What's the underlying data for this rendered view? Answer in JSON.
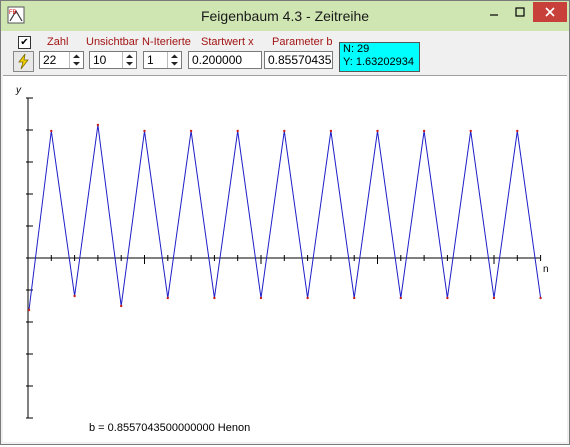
{
  "window": {
    "title": "Feigenbaum 4.3 - Zeitreihe"
  },
  "toolbar": {
    "labels": {
      "zahl": "Zahl",
      "unsichtbar": "Unsichtbar",
      "n_iterierte": "N-Iterierte",
      "startwert": "Startwert x",
      "parameter": "Parameter b"
    },
    "values": {
      "zahl": "22",
      "unsichtbar": "10",
      "n_iterierte": "1",
      "startwert": "0.200000",
      "parameter": "0.85570435"
    },
    "checkbox_checked": true
  },
  "readout": {
    "n": "N: 29",
    "y": "Y: 1.63202934"
  },
  "plot": {
    "y_axis_label": "y",
    "x_axis_label": "n",
    "footer": "b = 0.8557043500000000  Henon"
  },
  "colors": {
    "line": "#1e1ec8",
    "point": "#c81e1e",
    "readout_bg": "#00ffff",
    "label": "#a31515"
  }
}
